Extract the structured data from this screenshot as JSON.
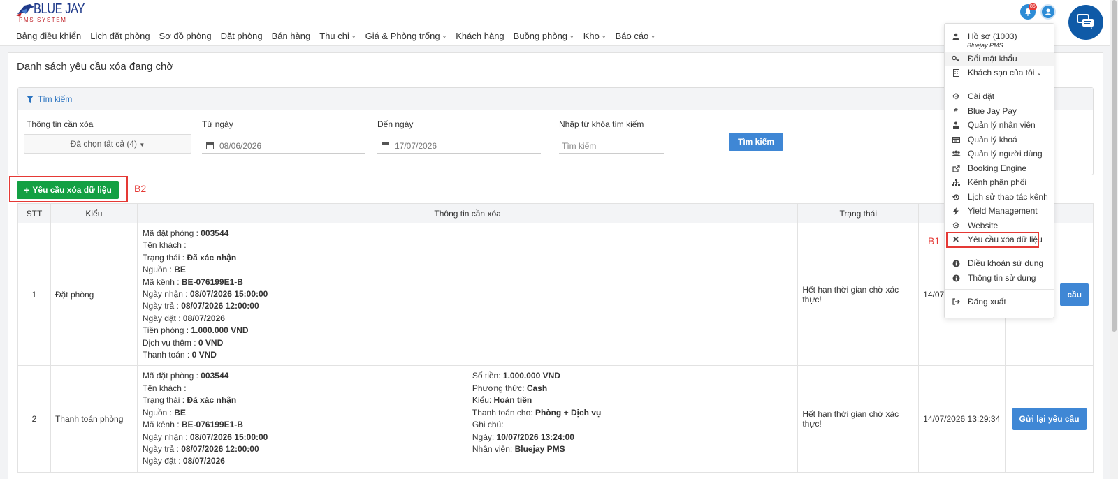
{
  "header": {
    "logo_brand": "BLUE JAY",
    "logo_sub": "PMS SYSTEM",
    "notification_count": "85",
    "nav": [
      {
        "label": "Bảng điều khiển",
        "dropdown": false
      },
      {
        "label": "Lịch đặt phòng",
        "dropdown": false
      },
      {
        "label": "Sơ đồ phòng",
        "dropdown": false
      },
      {
        "label": "Đặt phòng",
        "dropdown": false
      },
      {
        "label": "Bán hàng",
        "dropdown": false
      },
      {
        "label": "Thu chi",
        "dropdown": true
      },
      {
        "label": "Giá & Phòng trống",
        "dropdown": true
      },
      {
        "label": "Khách hàng",
        "dropdown": false
      },
      {
        "label": "Buồng phòng",
        "dropdown": true
      },
      {
        "label": "Kho",
        "dropdown": true
      },
      {
        "label": "Báo cáo",
        "dropdown": true
      }
    ]
  },
  "page": {
    "title": "Danh sách yêu cầu xóa đang chờ"
  },
  "search": {
    "header": "Tìm kiếm",
    "info_label": "Thông tin cần xóa",
    "info_value": "Đã chọn tất cả (4)",
    "from_label": "Từ ngày",
    "from_value": "08/06/2026",
    "to_label": "Đến ngày",
    "to_value": "17/07/2026",
    "keyword_label": "Nhập từ khóa tìm kiếm",
    "keyword_placeholder": "Tìm kiếm",
    "button": "Tìm kiếm"
  },
  "actions": {
    "add_request": "Yêu cầu xóa dữ liệu"
  },
  "annotations": {
    "b1": "B1",
    "b2": "B2"
  },
  "table": {
    "headers": [
      "STT",
      "Kiểu",
      "Thông tin cần xóa",
      "Trạng thái",
      ""
    ],
    "rows": [
      {
        "stt": "1",
        "type": "Đặt phòng",
        "booking": [
          {
            "label": "Mã đặt phòng : ",
            "value": "003544"
          },
          {
            "label": "Tên khách : ",
            "value": ""
          },
          {
            "label": "Trạng thái : ",
            "value": "Đã xác nhận"
          },
          {
            "label": "Nguồn : ",
            "value": "BE"
          },
          {
            "label": "Mã kênh : ",
            "value": "BE-076199E1-B"
          },
          {
            "label": "Ngày nhận : ",
            "value": "08/07/2026 15:00:00"
          },
          {
            "label": "Ngày trả : ",
            "value": "08/07/2026 12:00:00"
          },
          {
            "label": "Ngày đặt : ",
            "value": "08/07/2026"
          },
          {
            "label": "Tiền phòng : ",
            "value": "1.000.000 VND"
          },
          {
            "label": "Dịch vụ thêm : ",
            "value": "0 VND"
          },
          {
            "label": "Thanh toán : ",
            "value": "0 VND"
          }
        ],
        "status": "Hết hạn thời gian chờ xác thực!",
        "date": "14/07/",
        "button": "cầu"
      },
      {
        "stt": "2",
        "type": "Thanh toán phòng",
        "booking": [
          {
            "label": "Mã đặt phòng : ",
            "value": "003544"
          },
          {
            "label": "Tên khách : ",
            "value": ""
          },
          {
            "label": "Trạng thái : ",
            "value": "Đã xác nhận"
          },
          {
            "label": "Nguồn : ",
            "value": "BE"
          },
          {
            "label": "Mã kênh : ",
            "value": "BE-076199E1-B"
          },
          {
            "label": "Ngày nhận : ",
            "value": "08/07/2026 15:00:00"
          },
          {
            "label": "Ngày trả : ",
            "value": "08/07/2026 12:00:00"
          },
          {
            "label": "Ngày đặt : ",
            "value": "08/07/2026"
          }
        ],
        "payment": [
          {
            "label": "Số tiền: ",
            "value": "1.000.000 VND"
          },
          {
            "label": "Phương thức: ",
            "value": "Cash"
          },
          {
            "label": "Kiểu: ",
            "value": "Hoàn tiền"
          },
          {
            "label": "Thanh toán cho: ",
            "value": "Phòng + Dịch vụ"
          },
          {
            "label": "Ghi chú: ",
            "value": ""
          },
          {
            "label": "Ngày: ",
            "value": "10/07/2026 13:24:00"
          },
          {
            "label": "Nhân viên: ",
            "value": "Bluejay PMS"
          }
        ],
        "status": "Hết hạn thời gian chờ xác thực!",
        "date": "14/07/2026 13:29:34",
        "button": "Gửi lại yêu cầu"
      }
    ]
  },
  "user_menu": {
    "profile": "Hồ sơ (1003)",
    "profile_sub": "Bluejay PMS",
    "items": [
      {
        "label": "Đổi mật khẩu",
        "icon": "key-icon"
      },
      {
        "label": "Khách sạn của tôi",
        "icon": "building-icon"
      },
      {
        "label": "Cài đặt",
        "icon": "gear-icon"
      },
      {
        "label": "Blue Jay Pay",
        "icon": "asterisk-icon"
      },
      {
        "label": "Quản lý nhân viên",
        "icon": "staff-icon"
      },
      {
        "label": "Quản lý khoá",
        "icon": "card-icon"
      },
      {
        "label": "Quản lý người dùng",
        "icon": "users-icon"
      },
      {
        "label": "Booking Engine",
        "icon": "external-link-icon"
      },
      {
        "label": "Kênh phân phối",
        "icon": "sitemap-icon"
      },
      {
        "label": "Lịch sử thao tác kênh",
        "icon": "history-icon"
      },
      {
        "label": "Yield Management",
        "icon": "bolt-icon"
      },
      {
        "label": "Website",
        "icon": "gear-icon"
      },
      {
        "label": "Yêu cầu xóa dữ liệu",
        "icon": "close-icon"
      },
      {
        "label": "Điều khoản sử dụng",
        "icon": "info-icon"
      },
      {
        "label": "Thông tin sử dụng",
        "icon": "info-icon"
      },
      {
        "label": "Đăng xuất",
        "icon": "logout-icon"
      }
    ]
  },
  "colors": {
    "primary": "#3f87d5",
    "success": "#13a043",
    "highlight": "#e53935",
    "brand": "#1f3a8a"
  }
}
